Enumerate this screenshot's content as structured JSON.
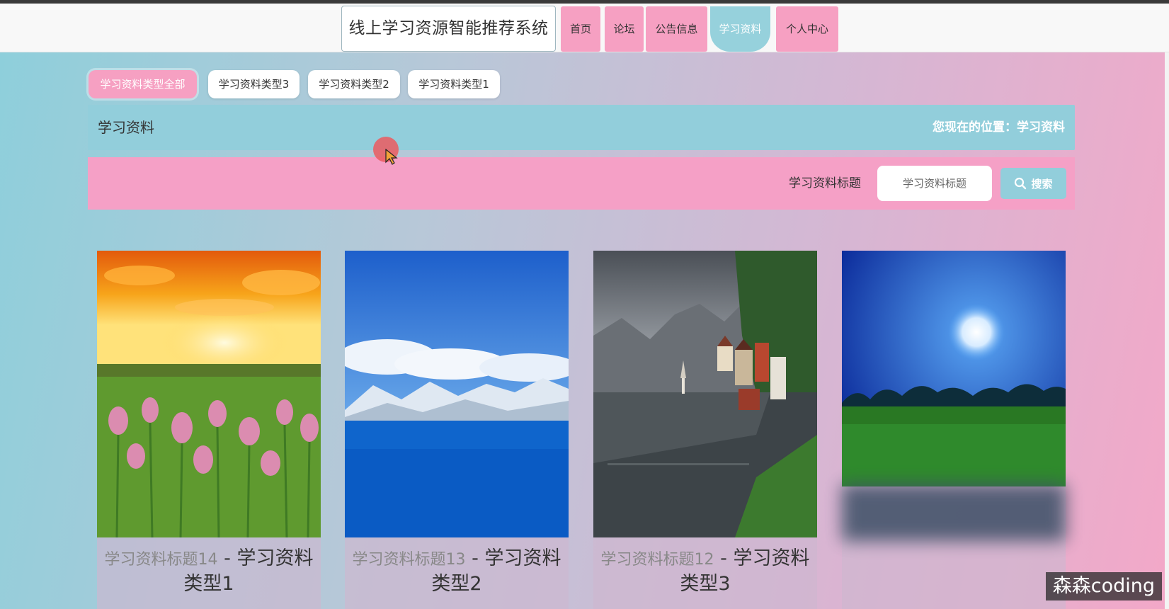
{
  "header": {
    "site_title": "线上学习资源智能推荐系统",
    "nav": [
      {
        "label": "首页",
        "active": false
      },
      {
        "label": "论坛",
        "active": false
      },
      {
        "label": "公告信息",
        "active": false
      },
      {
        "label": "学习资料",
        "active": true
      },
      {
        "label": "个人中心",
        "active": false
      }
    ]
  },
  "filters": [
    {
      "label": "学习资料类型全部",
      "active": true
    },
    {
      "label": "学习资料类型3",
      "active": false
    },
    {
      "label": "学习资料类型2",
      "active": false
    },
    {
      "label": "学习资料类型1",
      "active": false
    }
  ],
  "breadcrumb": {
    "title": "学习资料",
    "location": "您现在的位置：学习资料"
  },
  "search": {
    "label": "学习资料标题",
    "placeholder": "学习资料标题",
    "button_label": "搜索",
    "button_icon": "search-icon"
  },
  "cards": [
    {
      "title": "学习资料标题14",
      "sep": " - ",
      "type": "学习资料类型1",
      "image": "sunset-flower-field"
    },
    {
      "title": "学习资料标题13",
      "sep": " - ",
      "type": "学习资料类型2",
      "image": "snowy-mountain-lake"
    },
    {
      "title": "学习资料标题12",
      "sep": " - ",
      "type": "学习资料类型3",
      "image": "lakeside-village"
    },
    {
      "title": "",
      "sep": "",
      "type": "",
      "image": "moonlit-meadow"
    }
  ],
  "watermark": "森森coding",
  "colors": {
    "pink": "#f6a0c2",
    "teal": "#92cedb"
  }
}
